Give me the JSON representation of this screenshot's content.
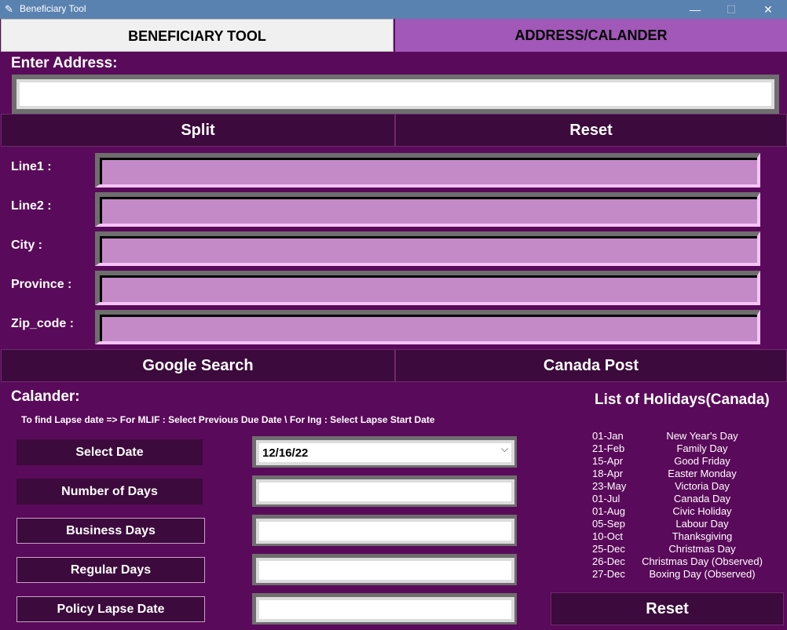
{
  "window": {
    "title": "Beneficiary Tool",
    "icon": "feather-icon",
    "controls": {
      "minimize": "—",
      "maximize": "☐",
      "close": "✕"
    }
  },
  "tabs": [
    {
      "label": "BENEFICIARY TOOL",
      "selected": false
    },
    {
      "label": "ADDRESS/CALANDER",
      "selected": true
    }
  ],
  "address": {
    "heading": "Enter Address:",
    "value": "",
    "split_label": "Split",
    "reset_label": "Reset"
  },
  "fields": [
    {
      "label": "Line1 :",
      "value": ""
    },
    {
      "label": "Line2 :",
      "value": ""
    },
    {
      "label": "City :",
      "value": ""
    },
    {
      "label": "Province :",
      "value": ""
    },
    {
      "label": "Zip_code :",
      "value": ""
    }
  ],
  "lookup": {
    "google_label": "Google Search",
    "canada_post_label": "Canada Post"
  },
  "calendar": {
    "heading": "Calander:",
    "note": "To find Lapse date => For MLIF : Select Previous Due Date \\ For Ing : Select Lapse Start Date",
    "rows": [
      {
        "label": "Select Date",
        "value": "12/16/22"
      },
      {
        "label": "Number of Days",
        "value": ""
      },
      {
        "label": "Business Days",
        "value": ""
      },
      {
        "label": "Regular Days",
        "value": ""
      },
      {
        "label": "Policy Lapse Date",
        "value": ""
      }
    ],
    "reset_label": "Reset"
  },
  "holidays": {
    "title": "List of Holidays(Canada)",
    "items": [
      {
        "date": "01-Jan",
        "name": "New Year's Day"
      },
      {
        "date": "21-Feb",
        "name": "Family Day"
      },
      {
        "date": "15-Apr",
        "name": "Good Friday"
      },
      {
        "date": "18-Apr",
        "name": "Easter Monday"
      },
      {
        "date": "23-May",
        "name": "Victoria Day"
      },
      {
        "date": "01-Jul",
        "name": "Canada Day"
      },
      {
        "date": "01-Aug",
        "name": "Civic Holiday"
      },
      {
        "date": "05-Sep",
        "name": "Labour Day"
      },
      {
        "date": "10-Oct",
        "name": "Thanksgiving"
      },
      {
        "date": "25-Dec",
        "name": "Christmas Day"
      },
      {
        "date": "26-Dec",
        "name": "Christmas Day (Observed)"
      },
      {
        "date": "27-Dec",
        "name": "Boxing Day (Observed)"
      }
    ]
  },
  "colors": {
    "background": "#5a0a5a",
    "button": "#3c0a3c",
    "active_tab": "#a158b8",
    "entry_fill": "#c48ac8",
    "titlebar": "#5a82b0"
  }
}
